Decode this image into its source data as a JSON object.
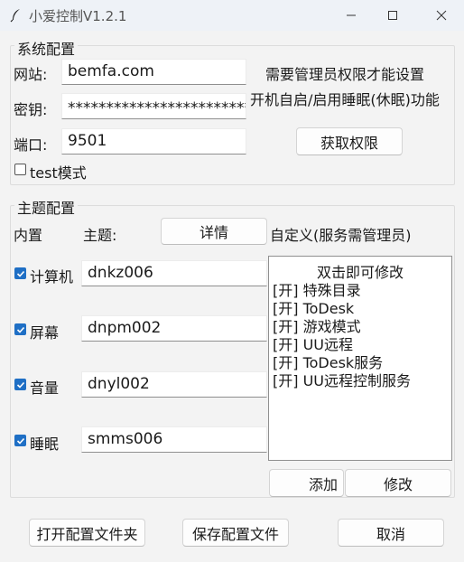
{
  "window": {
    "title": "小爱控制V1.2.1"
  },
  "system": {
    "legend": "系统配置",
    "site_label": "网站:",
    "site_value": "bemfa.com",
    "key_label": "密钥:",
    "key_value": "****************************",
    "port_label": "端口:",
    "port_value": "9501",
    "note1": "需要管理员权限才能设置",
    "note2": "开机自启/启用睡眠(休眠)功能",
    "get_permission_button": "获取权限",
    "test_mode_label": "test模式"
  },
  "theme": {
    "legend": "主题配置",
    "builtin_label": "内置",
    "theme_label": "主题:",
    "details_button": "详情",
    "custom_label": "自定义(服务需管理员)",
    "rows": [
      {
        "label": "计算机",
        "value": "dnkz006"
      },
      {
        "label": "屏幕",
        "value": "dnpm002"
      },
      {
        "label": "音量",
        "value": "dnyl002"
      },
      {
        "label": "睡眠",
        "value": "smms006"
      }
    ],
    "list_header": "双击即可修改",
    "list_items": [
      "[开] 特殊目录",
      "[开] ToDesk",
      "[开] 游戏模式",
      "[开] UU远程",
      "[开] ToDesk服务",
      "[开] UU远程控制服务"
    ],
    "add_button": "添加",
    "modify_button": "修改"
  },
  "footer": {
    "open_folder_button": "打开配置文件夹",
    "save_button": "保存配置文件",
    "cancel_button": "取消"
  },
  "colors": {
    "accent": "#1f6fc5",
    "background": "#f3f3f3"
  }
}
